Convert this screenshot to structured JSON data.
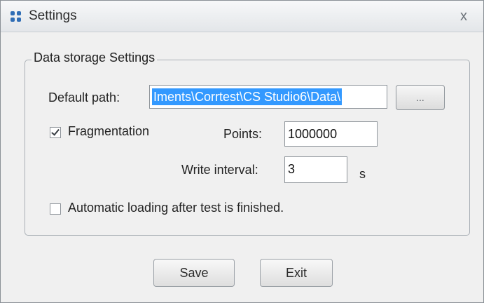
{
  "window": {
    "title": "Settings",
    "close_label": "x"
  },
  "group": {
    "legend": "Data storage Settings"
  },
  "default_path": {
    "label": "Default path:",
    "value": "Iments\\Corrtest\\CS Studio6\\Data\\",
    "browse_label": "..."
  },
  "fragmentation": {
    "label": "Fragmentation",
    "checked": true
  },
  "points": {
    "label": "Points:",
    "value": "1000000"
  },
  "write_interval": {
    "label": "Write interval:",
    "value": "3",
    "unit": "s"
  },
  "auto_load": {
    "label": "Automatic loading after test is finished.",
    "checked": false
  },
  "buttons": {
    "save_label": "Save",
    "exit_label": "Exit"
  }
}
